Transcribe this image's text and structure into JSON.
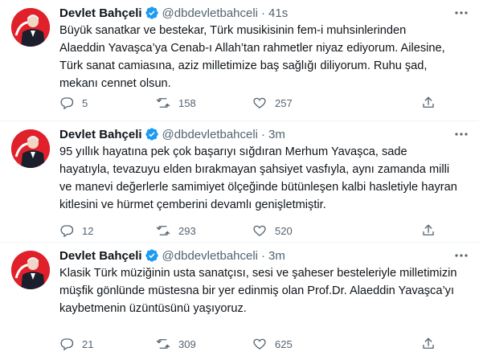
{
  "tweets": [
    {
      "name": "Devlet Bahçeli",
      "handle": "@dbdevletbahceli",
      "dot": "·",
      "time": "41s",
      "text": "Büyük sanatkar ve bestekar, Türk musikisinin fem-i muhsinlerinden\nAlaeddin Yavaşca’ya Cenab-ı Allah’tan rahmetler niyaz ediyorum. Ailesine,\nTürk sanat camiasına, aziz milletimize baş sağlığı diliyorum. Ruhu şad,\nmekanı cennet olsun.",
      "replies": "5",
      "retweets": "158",
      "likes": "257"
    },
    {
      "name": "Devlet Bahçeli",
      "handle": "@dbdevletbahceli",
      "dot": "·",
      "time": "3m",
      "text": "95 yıllık hayatına pek çok başarıyı sığdıran Merhum Yavaşca, sade\nhayatıyla, tevazuyu elden bırakmayan şahsiyet vasfıyla, aynı zamanda milli\nve manevi değerlerle samimiyet ölçeğinde bütünleşen kalbi hasletiyle hayran\nkitlesini ve hürmet çemberini devamlı genişletmiştir.",
      "replies": "12",
      "retweets": "293",
      "likes": "520"
    },
    {
      "name": "Devlet Bahçeli",
      "handle": "@dbdevletbahceli",
      "dot": "·",
      "time": "3m",
      "text": "Klasik Türk müziğinin usta sanatçısı, sesi ve şaheser besteleriyle milletimizin\nmüşfik gönlünde müstesna bir yer edinmiş olan Prof.Dr. Alaeddin Yavaşca’yı\nkaybetmenin üzüntüsünü yaşıyoruz.",
      "replies": "21",
      "retweets": "309",
      "likes": "625"
    }
  ],
  "colors": {
    "verified": "#1d9bf0",
    "muted": "#536471",
    "text": "#0f1419",
    "avatar_bg": "#e0202a"
  },
  "icons": [
    "verified-badge-icon",
    "more-icon",
    "reply-icon",
    "retweet-icon",
    "like-icon",
    "share-icon"
  ]
}
